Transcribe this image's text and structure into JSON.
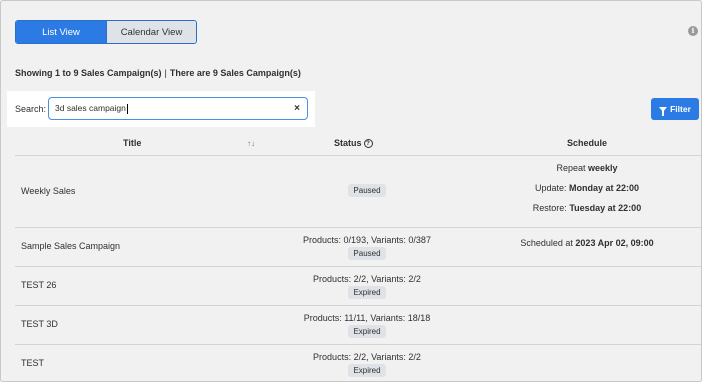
{
  "view_toggle": {
    "list_label": "List View",
    "calendar_label": "Calendar View"
  },
  "summary": {
    "showing": "Showing 1 to 9 Sales Campaign(s)",
    "separator": "|",
    "total": "There are 9 Sales Campaign(s)"
  },
  "search": {
    "label": "Search:",
    "value": "3d sales campaign"
  },
  "filter_label": "Filter",
  "table": {
    "headers": {
      "title": "Title",
      "status": "Status",
      "schedule": "Schedule"
    },
    "rows": [
      {
        "title": "Weekly Sales",
        "status": "Paused",
        "schedule": {
          "repeat_prefix": "Repeat",
          "repeat_value": "weekly",
          "update_prefix": "Update:",
          "update_value": "Monday at 22:00",
          "restore_prefix": "Restore:",
          "restore_value": "Tuesday at 22:00"
        }
      },
      {
        "title": "Sample Sales Campaign",
        "products": "Products: 0/193, Variants: 0/387",
        "status": "Paused",
        "schedule": {
          "scheduled_prefix": "Scheduled at",
          "scheduled_value": "2023 Apr 02, 09:00"
        }
      },
      {
        "title": "TEST 26",
        "products": "Products: 2/2, Variants: 2/2",
        "status": "Expired"
      },
      {
        "title": "TEST 3D",
        "products": "Products: 11/11, Variants: 18/18",
        "status": "Expired"
      },
      {
        "title": "TEST",
        "products": "Products: 2/2, Variants: 2/2",
        "status": "Expired"
      }
    ]
  },
  "colors": {
    "accent": "#2c7be5",
    "background": "#f1f1f1",
    "badge": "#dfe3e8"
  }
}
